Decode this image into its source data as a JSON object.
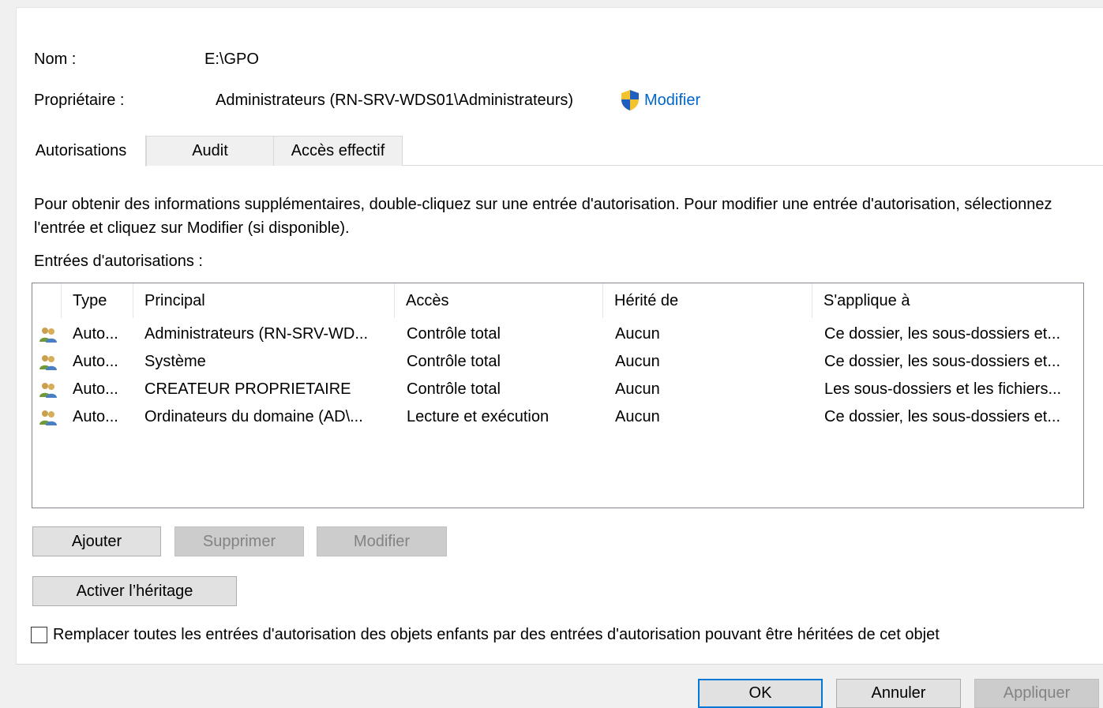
{
  "header": {
    "name_label": "Nom :",
    "name_value": "E:\\GPO",
    "owner_label": "Propriétaire :",
    "owner_value": "Administrateurs (RN-SRV-WDS01\\Administrateurs)",
    "modify_link": "Modifier",
    "shield_icon": "uac-shield-icon"
  },
  "tabs": [
    {
      "label": "Autorisations",
      "active": true
    },
    {
      "label": "Audit",
      "active": false
    },
    {
      "label": "Accès effectif",
      "active": false
    }
  ],
  "info_text": "Pour obtenir des informations supplémentaires, double-cliquez sur une entrée d'autorisation. Pour modifier une entrée d'autorisation, sélectionnez l'entrée et cliquez sur Modifier (si disponible).",
  "entries_label": "Entrées d'autorisations :",
  "list": {
    "columns": [
      "Type",
      "Principal",
      "Accès",
      "Hérité de",
      "S'applique à"
    ],
    "rows": [
      {
        "icon": "users-icon",
        "type": "Auto...",
        "principal": "Administrateurs (RN-SRV-WD...",
        "access": "Contrôle total",
        "inherited": "Aucun",
        "applies": "Ce dossier, les sous-dossiers et..."
      },
      {
        "icon": "users-icon",
        "type": "Auto...",
        "principal": "Système",
        "access": "Contrôle total",
        "inherited": "Aucun",
        "applies": "Ce dossier, les sous-dossiers et..."
      },
      {
        "icon": "users-icon",
        "type": "Auto...",
        "principal": "CREATEUR PROPRIETAIRE",
        "access": "Contrôle total",
        "inherited": "Aucun",
        "applies": "Les sous-dossiers et les fichiers..."
      },
      {
        "icon": "users-icon",
        "type": "Auto...",
        "principal": "Ordinateurs du domaine (AD\\...",
        "access": "Lecture et exécution",
        "inherited": "Aucun",
        "applies": "Ce dossier, les sous-dossiers et..."
      }
    ]
  },
  "buttons": {
    "add": "Ajouter",
    "delete": "Supprimer",
    "modify": "Modifier",
    "enable_inheritance": "Activer l’héritage"
  },
  "replace_checkbox": {
    "label": "Remplacer toutes les entrées d'autorisation des objets enfants par des entrées d'autorisation pouvant être héritées de cet objet",
    "checked": false
  },
  "footer": {
    "ok": "OK",
    "cancel": "Annuler",
    "apply": "Appliquer"
  },
  "colors": {
    "link": "#0066cc",
    "focus_border": "#0078d7",
    "disabled_bg": "#cccccc"
  }
}
